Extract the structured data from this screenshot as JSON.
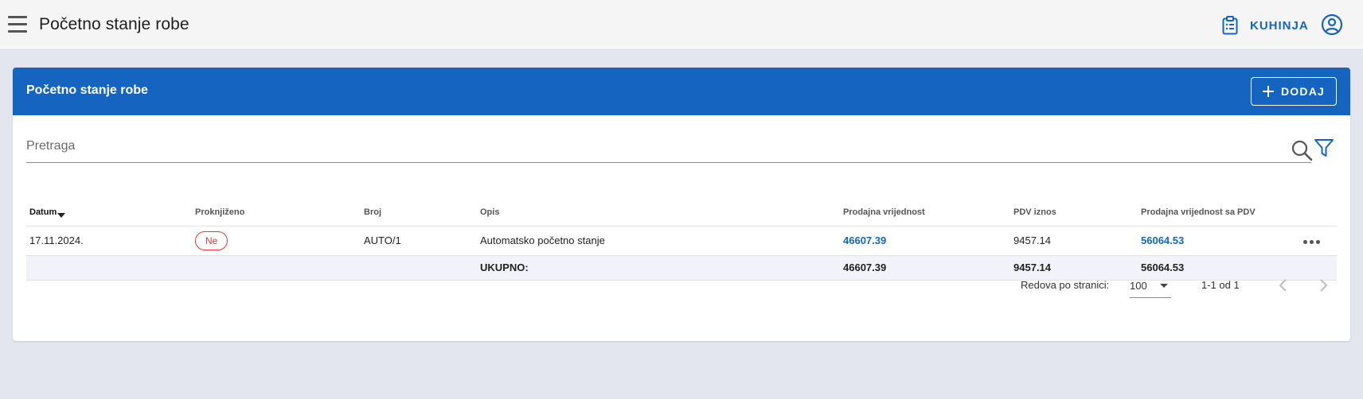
{
  "topbar": {
    "title": "Početno stanje robe",
    "menu_icon": "hamburger-menu-icon",
    "kitchen_label": "KUHINJA",
    "kitchen_icon": "clipboard-list-icon",
    "account_icon": "account-circle-icon"
  },
  "card": {
    "title": "Početno stanje robe",
    "add_label": "DODAJ",
    "add_icon": "plus-icon"
  },
  "search": {
    "placeholder": "Pretraga",
    "value": "",
    "search_icon": "search-icon",
    "filter_icon": "filter-icon"
  },
  "table": {
    "headers": {
      "datum": "Datum",
      "proknjizeno": "Proknjiženo",
      "broj": "Broj",
      "opis": "Opis",
      "prodajna": "Prodajna vrijednost",
      "pdv": "PDV iznos",
      "prodajna_pdv": "Prodajna vrijednost sa PDV"
    },
    "rows": [
      {
        "datum": "17.11.2024.",
        "proknjizeno": "Ne",
        "broj": "AUTO/1",
        "opis": "Automatsko početno stanje",
        "prodajna": "46607.39",
        "pdv": "9457.14",
        "prodajna_pdv": "56064.53"
      }
    ],
    "total": {
      "label": "UKUPNO:",
      "prodajna": "46607.39",
      "pdv": "9457.14",
      "prodajna_pdv": "56064.53"
    }
  },
  "pagination": {
    "rows_per_page_label": "Redova po stranici:",
    "rows_per_page": "100",
    "range": "1-1 od 1"
  },
  "colors": {
    "primary": "#1565c0",
    "danger": "#e53935",
    "background": "#e4e6ef"
  }
}
